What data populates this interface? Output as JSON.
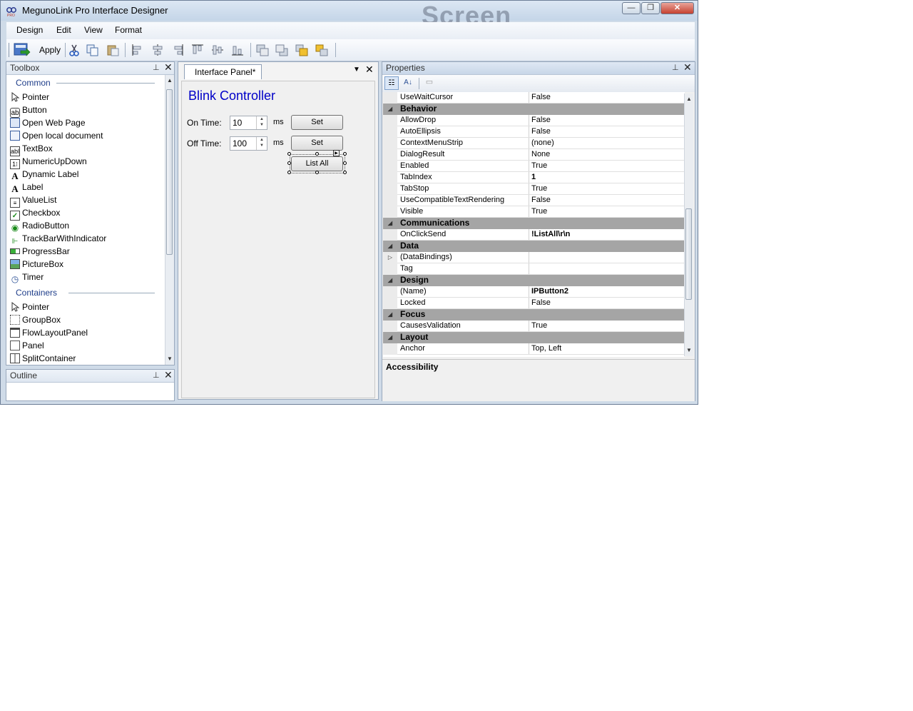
{
  "window": {
    "title": "MegunoLink Pro Interface Designer",
    "ghost_text": "Screen",
    "controls": [
      "—",
      "❐",
      "✕"
    ]
  },
  "menu": [
    "Design",
    "Edit",
    "View",
    "Format"
  ],
  "toolbar": {
    "apply_label": "Apply"
  },
  "toolbox": {
    "title": "Toolbox",
    "sections": [
      {
        "label": "Common",
        "items": [
          "Pointer",
          "Button",
          "Open Web Page",
          "Open local document",
          "TextBox",
          "NumericUpDown",
          "Dynamic Label",
          "Label",
          "ValueList",
          "Checkbox",
          "RadioButton",
          "TrackBarWithIndicator",
          "ProgressBar",
          "PictureBox",
          "Timer"
        ]
      },
      {
        "label": "Containers",
        "items": [
          "Pointer",
          "GroupBox",
          "FlowLayoutPanel",
          "Panel",
          "SplitContainer"
        ]
      }
    ]
  },
  "outline": {
    "title": "Outline"
  },
  "designer": {
    "tab_label": "Interface Panel*",
    "heading": "Blink Controller",
    "on_time_label": "On Time:",
    "on_time_value": "10",
    "off_time_label": "Off Time:",
    "off_time_value": "100",
    "unit": "ms",
    "set_label": "Set",
    "list_all_label": "List All"
  },
  "properties": {
    "title": "Properties",
    "description_title": "Accessibility",
    "rows": [
      {
        "type": "prop",
        "name": "UseWaitCursor",
        "value": "False"
      },
      {
        "type": "cat",
        "name": "Behavior"
      },
      {
        "type": "prop",
        "name": "AllowDrop",
        "value": "False"
      },
      {
        "type": "prop",
        "name": "AutoEllipsis",
        "value": "False"
      },
      {
        "type": "prop",
        "name": "ContextMenuStrip",
        "value": "(none)"
      },
      {
        "type": "prop",
        "name": "DialogResult",
        "value": "None"
      },
      {
        "type": "prop",
        "name": "Enabled",
        "value": "True"
      },
      {
        "type": "prop",
        "name": "TabIndex",
        "value": "1",
        "bold": true
      },
      {
        "type": "prop",
        "name": "TabStop",
        "value": "True"
      },
      {
        "type": "prop",
        "name": "UseCompatibleTextRendering",
        "value": "False"
      },
      {
        "type": "prop",
        "name": "Visible",
        "value": "True"
      },
      {
        "type": "cat",
        "name": "Communications"
      },
      {
        "type": "prop",
        "name": "OnClickSend",
        "value": "!ListAll\\r\\n",
        "bold": true
      },
      {
        "type": "cat",
        "name": "Data"
      },
      {
        "type": "prop",
        "name": "(DataBindings)",
        "value": "",
        "expandable": true
      },
      {
        "type": "prop",
        "name": "Tag",
        "value": ""
      },
      {
        "type": "cat",
        "name": "Design"
      },
      {
        "type": "prop",
        "name": "(Name)",
        "value": "IPButton2",
        "bold": true
      },
      {
        "type": "prop",
        "name": "Locked",
        "value": "False"
      },
      {
        "type": "cat",
        "name": "Focus"
      },
      {
        "type": "prop",
        "name": "CausesValidation",
        "value": "True"
      },
      {
        "type": "cat",
        "name": "Layout"
      },
      {
        "type": "prop",
        "name": "Anchor",
        "value": "Top, Left"
      }
    ]
  }
}
